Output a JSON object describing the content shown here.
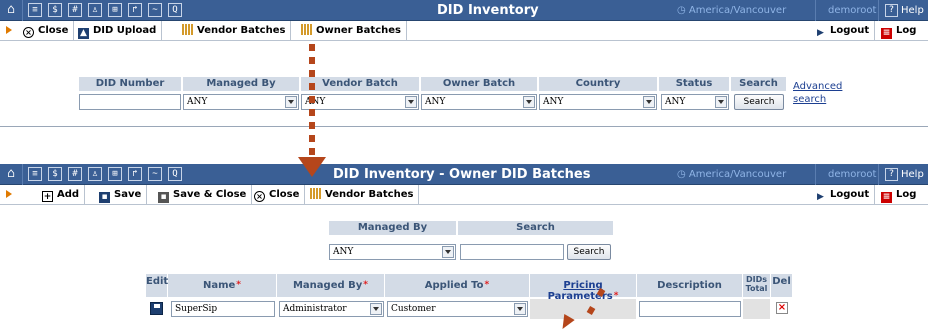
{
  "screen1": {
    "title": "DID Inventory",
    "timezone": "America/Vancouver",
    "user": "demoroot",
    "help": "Help",
    "toolbar": {
      "close": "Close",
      "did_upload": "DID Upload",
      "vendor_batches": "Vendor Batches",
      "owner_batches": "Owner Batches",
      "logout": "Logout",
      "log": "Log"
    },
    "search": {
      "headers": {
        "did_number": "DID Number",
        "managed_by": "Managed By",
        "vendor_batch": "Vendor Batch",
        "owner_batch": "Owner Batch",
        "country": "Country",
        "status": "Status",
        "search": "Search"
      },
      "values": {
        "did_number": "",
        "managed_by": "ANY",
        "vendor_batch": "ANY",
        "owner_batch": "ANY",
        "country": "ANY",
        "status": "ANY"
      },
      "search_button": "Search",
      "advanced_1": "Advanced",
      "advanced_2": "search"
    }
  },
  "screen2": {
    "title": "DID Inventory - Owner DID Batches",
    "timezone": "America/Vancouver",
    "user": "demoroot",
    "help": "Help",
    "toolbar": {
      "add": "Add",
      "save": "Save",
      "save_close": "Save & Close",
      "close": "Close",
      "vendor_batches": "Vendor Batches",
      "logout": "Logout",
      "log": "Log"
    },
    "filter": {
      "managed_by_label": "Managed By",
      "search_label": "Search",
      "managed_by_value": "ANY",
      "search_value": "",
      "search_button": "Search"
    },
    "table": {
      "headers": {
        "edit": "Edit",
        "name": "Name",
        "managed_by": "Managed By",
        "applied_to": "Applied To",
        "pricing": "Pricing Parameters",
        "description": "Description",
        "dids_total_1": "DIDs",
        "dids_total_2": "Total",
        "del": "Del"
      },
      "required_mark": "*",
      "row": {
        "name": "SuperSip",
        "managed_by": "Administrator",
        "applied_to": "Customer",
        "description": ""
      }
    }
  },
  "colors": {
    "navbar": "#3a5f95",
    "header_cell": "#d3dbe6",
    "accent_arrow": "#b5461b",
    "timezone_text": "#8fb4e6"
  }
}
